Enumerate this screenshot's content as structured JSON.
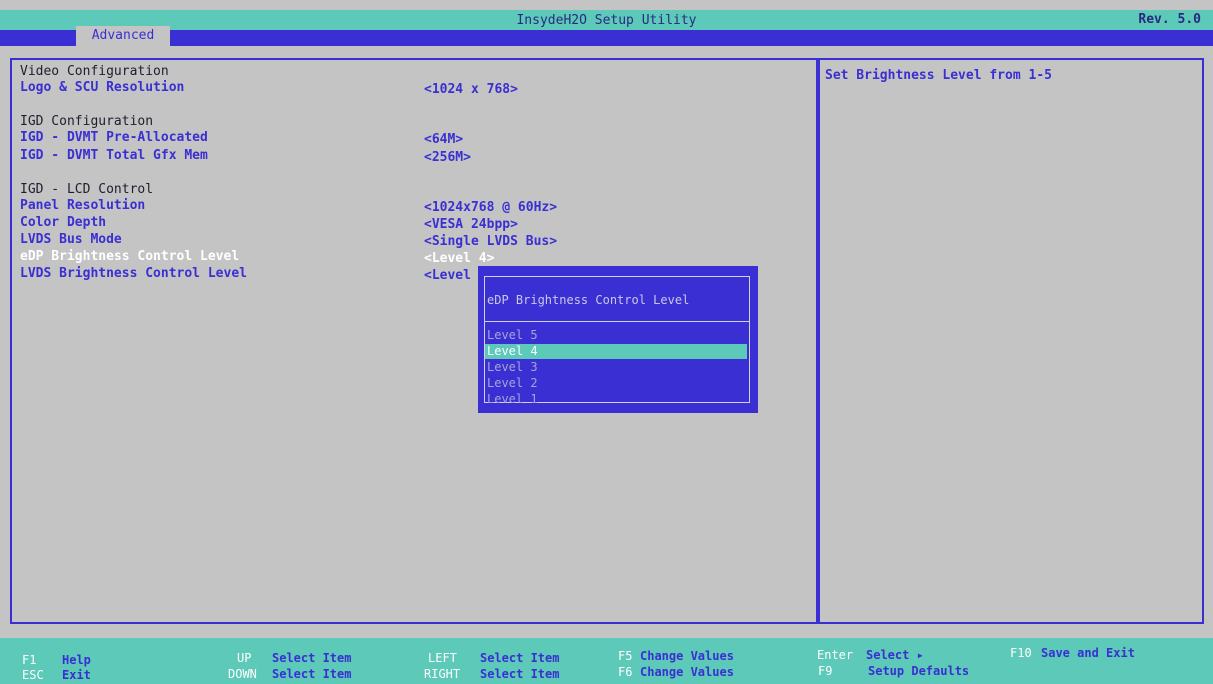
{
  "app": {
    "title": "InsydeH2O Setup Utility",
    "revision": "Rev. 5.0"
  },
  "tabs": {
    "advanced": "Advanced"
  },
  "settings": {
    "video_header": "Video Configuration",
    "logo_label": "Logo & SCU Resolution",
    "logo_value": "<1024 x 768>",
    "igd_header": "IGD Configuration",
    "prealloc_label": "IGD - DVMT Pre-Allocated",
    "prealloc_value": "<64M>",
    "total_label": "IGD - DVMT Total Gfx Mem",
    "total_value": "<256M>",
    "lcd_header": "IGD - LCD Control",
    "panel_label": "Panel Resolution",
    "panel_value": "<1024x768 @ 60Hz>",
    "depth_label": "Color Depth",
    "depth_value": "<VESA 24bpp>",
    "lvds_bus_label": "LVDS Bus Mode",
    "lvds_bus_value": "<Single LVDS Bus>",
    "edp_label": "eDP Brightness Control Level",
    "edp_value": "<Level 4>",
    "lvds_bright_label": "LVDS Brightness Control Level",
    "lvds_bright_value": "<Level"
  },
  "help_text": "Set Brightness Level from 1-5",
  "popup": {
    "title": "eDP Brightness Control Level",
    "options": [
      "Level 5",
      "Level 4",
      "Level 3",
      "Level 2",
      "Level 1"
    ],
    "selected": "Level 4"
  },
  "footer": {
    "f1_key": "F1",
    "f1_desc": "Help",
    "esc_key": "ESC",
    "esc_desc": "Exit",
    "up_key": "UP",
    "up_desc": "Select Item",
    "down_key": "DOWN",
    "down_desc": "Select Item",
    "left_key": "LEFT",
    "left_desc": "Select Item",
    "right_key": "RIGHT",
    "right_desc": "Select Item",
    "f5_key": "F5",
    "f5_desc": "Change Values",
    "f6_key": "F6",
    "f6_desc": "Change Values",
    "enter_key": "Enter",
    "enter_desc": "Select ▸",
    "f9_key": "F9",
    "f9_desc": "Setup Defaults",
    "f10_key": "F10",
    "f10_desc": "Save and Exit"
  },
  "colors": {
    "accent": "#3a2fd2",
    "teal": "#5cc9b9",
    "background": "#c4c4c4"
  }
}
